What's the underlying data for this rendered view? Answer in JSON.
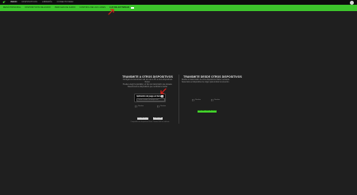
{
  "topbar": {
    "logo_icon": "razer-logo-icon",
    "nav": [
      "INICIO",
      "DISPOSITIVOS",
      "LIBRERÍA",
      "CONECTIVIDAD"
    ],
    "active_index": 0,
    "account_icon": "account-avatar-icon"
  },
  "subbar": {
    "tabs": [
      "MENÚ PRINCIPAL",
      "DISPOSITIVOS DE AUDIO",
      "PERFILES DE AUDIO",
      "CONTROL DE LAS LUCES",
      "LUZ DE ACTIVIDAD"
    ],
    "active_index": 4,
    "active_icon": "screen-cast-icon"
  },
  "left_panel": {
    "title": "TRANSMITE A OTROS DISPOSITIVOS",
    "description_lines": [
      "Configura la transmisión del uso de tu PC a otros dispositivos Razer.",
      "Puedes elegir la pantalla y el tipo de transmisión que deseas.",
      "Selecciona los dispositivos que recibirán la señal."
    ],
    "popup": {
      "label": "Aplicación de juego en tiempo",
      "input_text": "Iniciar sesión en tiempo real"
    },
    "devices": [
      "Nombre",
      "Nombre"
    ],
    "buttons": [
      "RESTABLECER",
      "GUARDAR"
    ],
    "note": "Compatible con dispositivos Razer Chroma RGB en adelante"
  },
  "right_panel": {
    "title": "TRANSMITE DESDE OTROS DISPOSITIVOS",
    "description_lines": [
      "Recibe la transmisión de otros dispositivos Razer cercanos.",
      "Selecciona el dispositivo de origen para iniciar la conexión."
    ],
    "devices": [
      "Nombre",
      "Nombre"
    ],
    "button": "BUSCAR DISPOSITIVOS"
  },
  "colors": {
    "accent": "#44d62c",
    "annotation_arrow": "#e0211b",
    "background": "#1f1f1f"
  }
}
